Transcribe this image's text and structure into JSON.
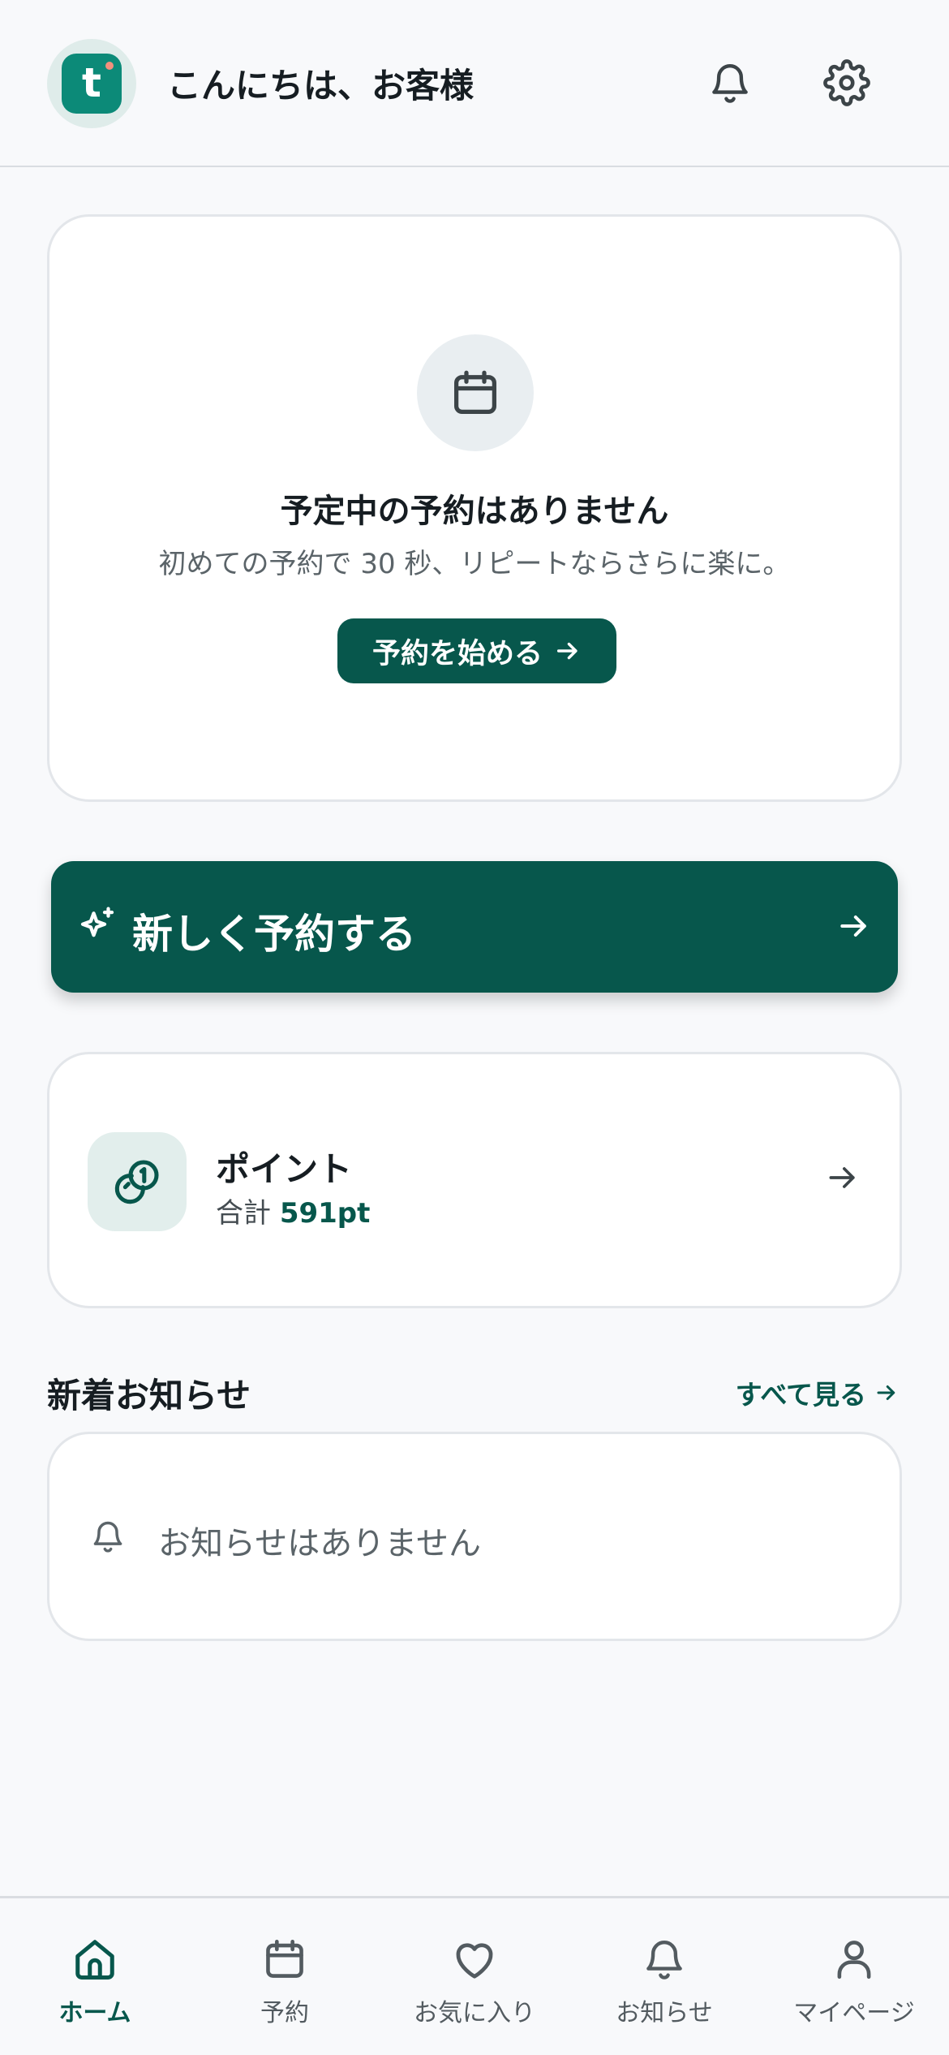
{
  "header": {
    "avatar_letter": "t",
    "greeting": "こんにちは、お客様",
    "icons": [
      "bell-icon",
      "gear-icon"
    ]
  },
  "empty_booking": {
    "icon": "calendar-icon",
    "title": "予定中の予約はありません",
    "subtitle": "初めての予約で 30 秒、リピートならさらに楽に。",
    "button_label": "予約を始める"
  },
  "new_booking": {
    "icon": "sparkle-icon",
    "label": "新しく予約する"
  },
  "points": {
    "icon": "coins-icon",
    "title": "ポイント",
    "total_label": "合計",
    "total_value": "591pt"
  },
  "news": {
    "heading": "新着お知らせ",
    "see_all": "すべて見る",
    "empty_text": "お知らせはありません"
  },
  "bottom_nav": {
    "items": [
      {
        "label": "ホーム",
        "icon": "home-icon",
        "active": true
      },
      {
        "label": "予約",
        "icon": "calendar-icon",
        "active": false
      },
      {
        "label": "お気に入り",
        "icon": "heart-icon",
        "active": false
      },
      {
        "label": "お知らせ",
        "icon": "bell-icon",
        "active": false
      },
      {
        "label": "マイページ",
        "icon": "user-icon",
        "active": false
      }
    ]
  },
  "colors": {
    "primary": "#07574c",
    "accent": "#0c8a78",
    "background": "#f8f9fb"
  }
}
